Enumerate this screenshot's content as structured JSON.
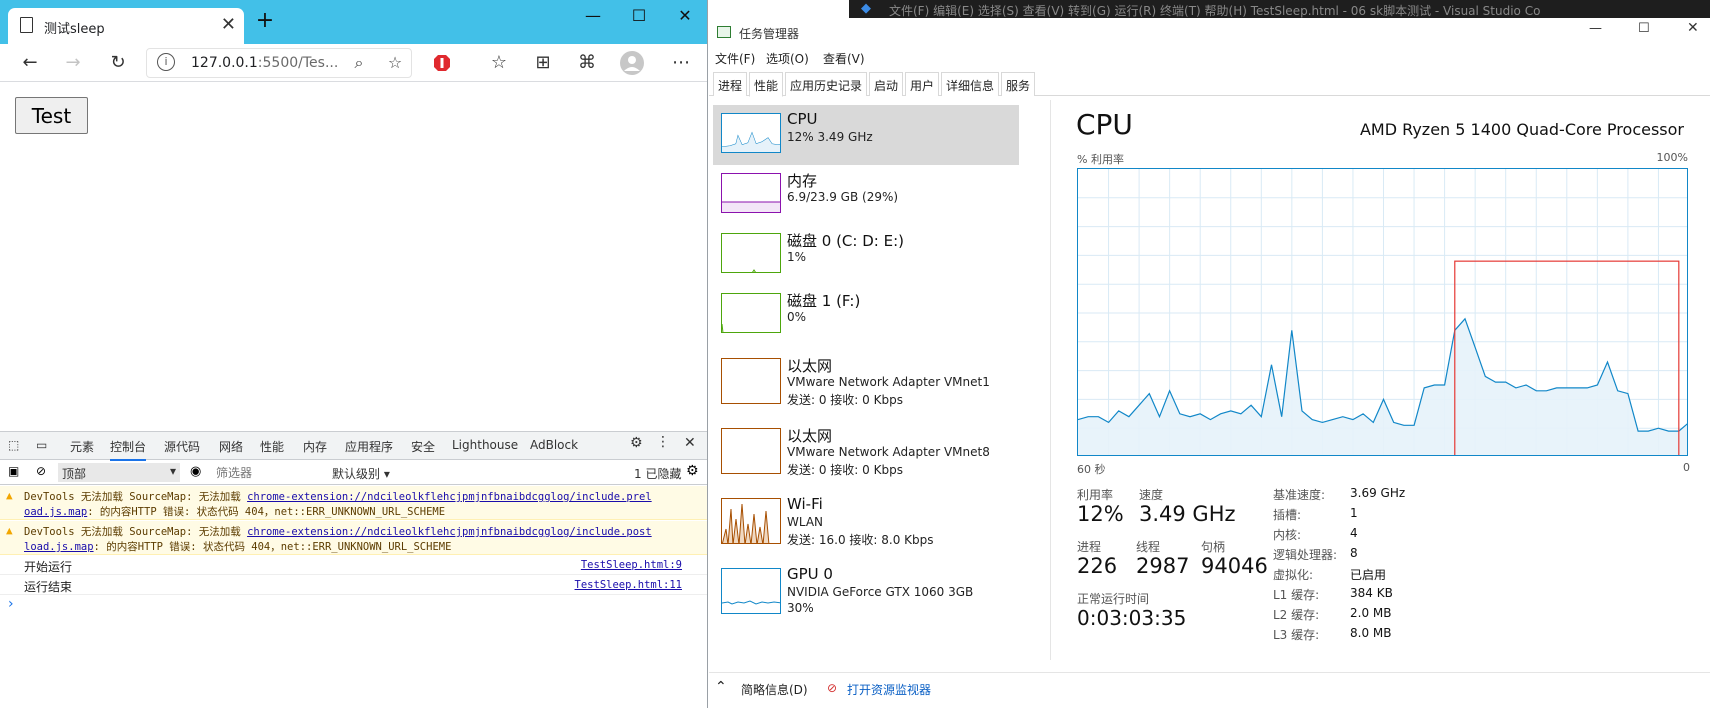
{
  "browser": {
    "tab_title": "测试sleep",
    "tab_close": "✕",
    "new_tab": "+",
    "window_controls": [
      "—",
      "☐",
      "✕"
    ],
    "url_host": "127.0.0.1",
    "url_rest": ":5500/Tes...",
    "test_button_label": "Test",
    "devtools": {
      "tabs": [
        "元素",
        "控制台",
        "源代码",
        "网络",
        "性能",
        "内存",
        "应用程序",
        "安全",
        "Lighthouse",
        "AdBlock"
      ],
      "context_select": "顶部",
      "filter_placeholder": "筛选器",
      "levels": "默认级别 ▾",
      "hidden_count": "1 已隐藏",
      "warnings": [
        {
          "prefix": "DevTools 无法加载 SourceMap: 无法加载 ",
          "link1": "chrome-extension://ndcileolkflehcjpmjnfbnaibdcgglog/include.prel",
          "link2": "oad.js.map",
          "suffix": ": 的内容HTTP 错误: 状态代码 404，net::ERR_UNKNOWN_URL_SCHEME"
        },
        {
          "prefix": "DevTools 无法加载 SourceMap: 无法加载 ",
          "link1": "chrome-extension://ndcileolkflehcjpmjnfbnaibdcgglog/include.post",
          "link2": "load.js.map",
          "suffix": ": 的内容HTTP 错误: 状态代码 404，net::ERR_UNKNOWN_URL_SCHEME"
        }
      ],
      "logs": [
        {
          "msg": "开始运行",
          "src": "TestSleep.html:9"
        },
        {
          "msg": "运行结束",
          "src": "TestSleep.html:11"
        }
      ],
      "prompt": "›"
    }
  },
  "vscode_title": "文件(F)  编辑(E)  选择(S)  查看(V)  转到(G)  运行(R)  终端(T)  帮助(H)          TestSleep.html - 06 sk脚本测试 - Visual Studio Co",
  "taskmgr": {
    "title": "任务管理器",
    "window_controls": [
      "—",
      "☐",
      "✕"
    ],
    "menu": [
      "文件(F)",
      "选项(O)",
      "查看(V)"
    ],
    "tabs": [
      "进程",
      "性能",
      "应用历史记录",
      "启动",
      "用户",
      "详细信息",
      "服务"
    ],
    "sidebar": [
      {
        "name": "CPU",
        "d1": "12% 3.49 GHz",
        "d2": "",
        "color": "#1187c8"
      },
      {
        "name": "内存",
        "d1": "6.9/23.9 GB (29%)",
        "d2": "",
        "color": "#8b12ae"
      },
      {
        "name": "磁盘 0 (C: D: E:)",
        "d1": "1%",
        "d2": "",
        "color": "#4da60c"
      },
      {
        "name": "磁盘 1 (F:)",
        "d1": "0%",
        "d2": "",
        "color": "#4da60c"
      },
      {
        "name": "以太网",
        "d1": "VMware Network Adapter VMnet1",
        "d2": "发送: 0 接收: 0 Kbps",
        "color": "#a74f01"
      },
      {
        "name": "以太网",
        "d1": "VMware Network Adapter VMnet8",
        "d2": "发送: 0 接收: 0 Kbps",
        "color": "#a74f01"
      },
      {
        "name": "Wi-Fi",
        "d1": "WLAN",
        "d2": "发送: 16.0 接收: 8.0 Kbps",
        "color": "#a74f01"
      },
      {
        "name": "GPU 0",
        "d1": "NVIDIA GeForce GTX 1060 3GB",
        "d2": "30%",
        "color": "#1187c8"
      }
    ],
    "cpu": {
      "title": "CPU",
      "processor": "AMD Ryzen 5 1400 Quad-Core Processor",
      "util_label": "% 利用率",
      "max_label": "100%",
      "time_left": "60 秒",
      "time_right": "0",
      "stats": {
        "util_label": "利用率",
        "util": "12%",
        "speed_label": "速度",
        "speed": "3.49 GHz",
        "proc_label": "进程",
        "proc": "226",
        "thread_label": "线程",
        "thread": "2987",
        "handle_label": "句柄",
        "handle": "94046",
        "uptime_label": "正常运行时间",
        "uptime": "0:03:03:35"
      },
      "details": [
        {
          "k": "基准速度:",
          "v": "3.69 GHz"
        },
        {
          "k": "插槽:",
          "v": "1"
        },
        {
          "k": "内核:",
          "v": "4"
        },
        {
          "k": "逻辑处理器:",
          "v": "8"
        },
        {
          "k": "虚拟化:",
          "v": "已启用"
        },
        {
          "k": "L1 缓存:",
          "v": "384 KB"
        },
        {
          "k": "L2 缓存:",
          "v": "2.0 MB"
        },
        {
          "k": "L3 缓存:",
          "v": "8.0 MB"
        }
      ]
    },
    "footer": {
      "brief": "简略信息(D)",
      "resmon": "打开资源监视器"
    },
    "chart_data": {
      "type": "area",
      "ylabel": "% 利用率",
      "ylim": [
        0,
        100
      ],
      "xlim": [
        60,
        0
      ],
      "grid": true,
      "color": "#1187c8",
      "highlight_color": "#e53935",
      "highlight_x": [
        23,
        1
      ],
      "x": [
        60,
        59,
        58,
        57,
        56,
        55,
        54,
        53,
        52,
        51,
        50,
        49,
        48,
        47,
        46,
        45,
        44,
        43,
        42,
        41,
        40,
        39,
        38,
        37,
        36,
        35,
        34,
        33,
        32,
        31,
        30,
        29,
        28,
        27,
        26,
        25,
        24,
        23,
        22,
        21,
        20,
        19,
        18,
        17,
        16,
        15,
        14,
        13,
        12,
        11,
        10,
        9,
        8,
        7,
        6,
        5,
        4,
        3,
        2,
        1,
        0
      ],
      "y": [
        13,
        14,
        14,
        12,
        16,
        14,
        18,
        22,
        14,
        23,
        15,
        14,
        15,
        13,
        15,
        16,
        15,
        18,
        14,
        32,
        14,
        44,
        16,
        13,
        12,
        13,
        14,
        13,
        15,
        12,
        20,
        12,
        11,
        11,
        24,
        25,
        25,
        44,
        48,
        38,
        28,
        26,
        26,
        24,
        25,
        23,
        23,
        24,
        24,
        24,
        24,
        25,
        33,
        23,
        22,
        9,
        9,
        10,
        9,
        9,
        12
      ]
    }
  }
}
